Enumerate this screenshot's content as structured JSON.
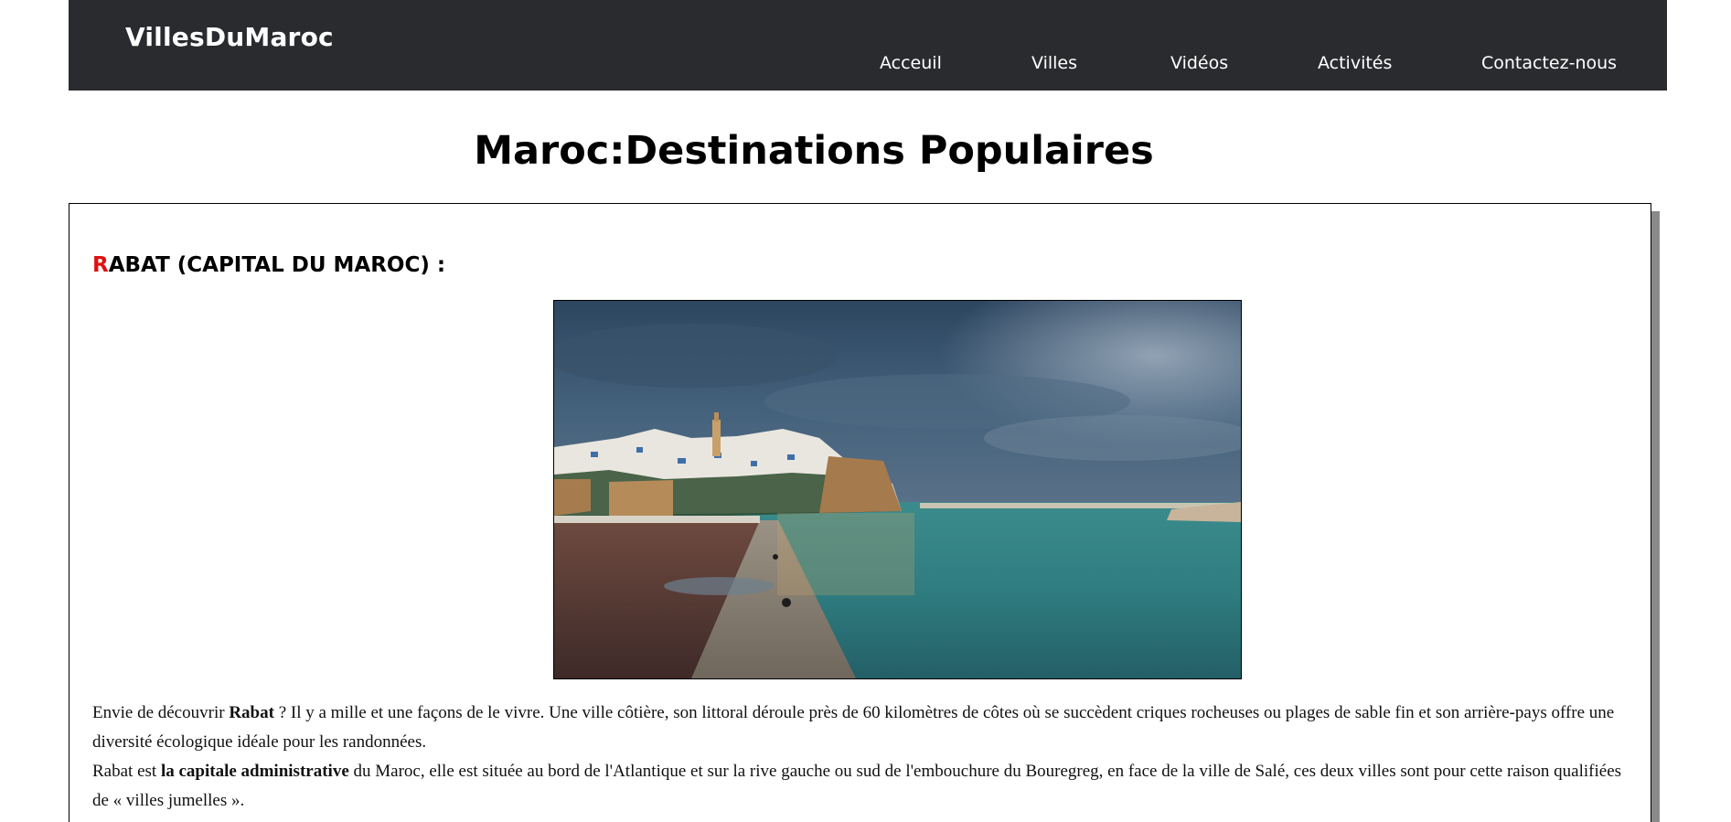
{
  "navbar": {
    "brand": "VillesDuMaroc",
    "items": [
      {
        "label": "Acceuil"
      },
      {
        "label": "Villes"
      },
      {
        "label": "Vidéos"
      },
      {
        "label": "Activités"
      },
      {
        "label": "Contactez-nous"
      }
    ],
    "background_color": "#292b2e"
  },
  "page": {
    "title": "Maroc:Destinations Populaires"
  },
  "city": {
    "heading_initial": "R",
    "heading_rest": "ABAT (CAPITAL DU MAROC) :",
    "accent_color": "#e01010",
    "photo_name": "rabat-kasbah-oudayas-photo",
    "paragraph1": {
      "t1": "Envie de découvrir ",
      "b1": "Rabat",
      "t2": " ? Il y a mille et une façons de le vivre. Une ville côtière, son littoral déroule près de 60 kilomètres de côtes où se succèdent criques rocheuses ou plages de sable fin et son arrière-pays offre une diversité écologique idéale pour les randonnées."
    },
    "paragraph2": {
      "t1": "Rabat est ",
      "b1": "la capitale administrative",
      "t2": " du Maroc, elle est située au bord de l'Atlantique et sur la rive gauche ou sud de l'embouchure du Bouregreg, en face de la ville de Salé, ces deux villes sont pour cette raison qualifiées de « villes jumelles »."
    }
  }
}
